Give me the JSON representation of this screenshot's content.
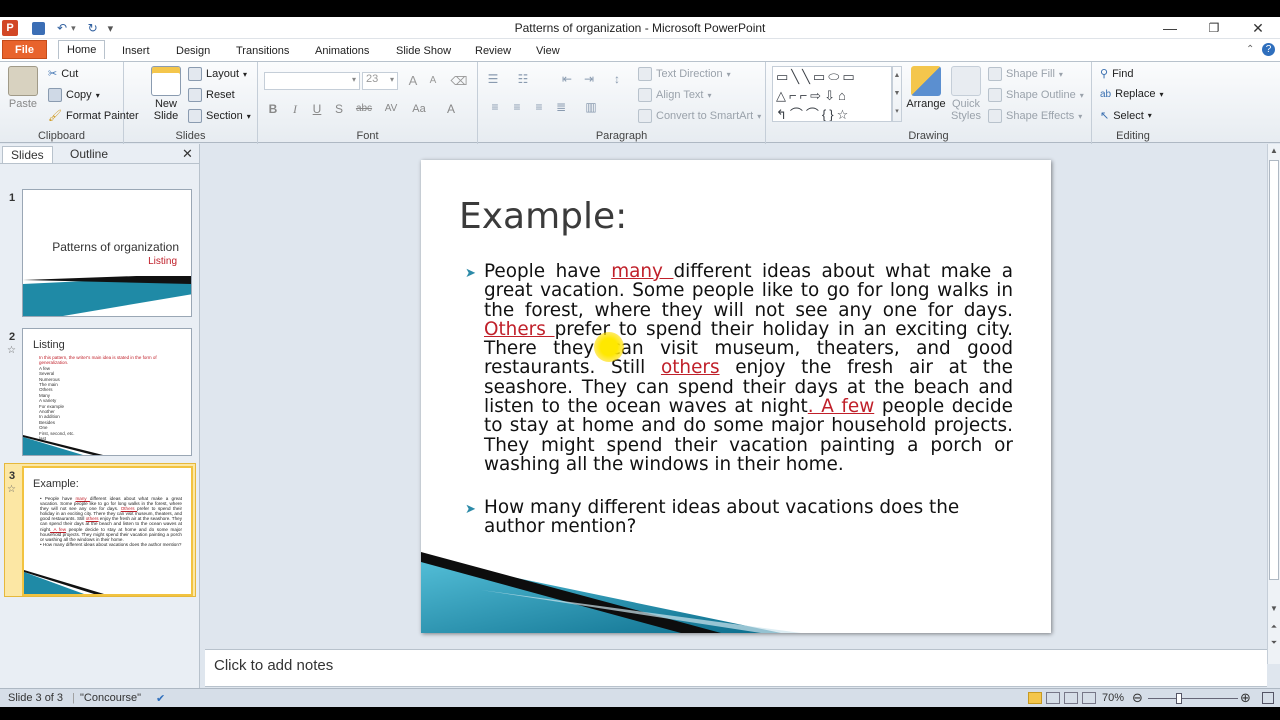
{
  "window": {
    "title": "Patterns of organization  -  Microsoft PowerPoint"
  },
  "tabs": [
    "File",
    "Home",
    "Insert",
    "Design",
    "Transitions",
    "Animations",
    "Slide Show",
    "Review",
    "View"
  ],
  "ribbon": {
    "clipboard": {
      "label": "Clipboard",
      "paste": "Paste",
      "cut": "Cut",
      "copy": "Copy",
      "format_painter": "Format Painter"
    },
    "slides": {
      "label": "Slides",
      "new_slide": "New Slide",
      "layout": "Layout",
      "reset": "Reset",
      "section": "Section"
    },
    "font": {
      "label": "Font",
      "font_name": "",
      "font_size": "23",
      "bold": "B",
      "italic": "I",
      "underline": "U",
      "shadow": "S",
      "strike": "abc",
      "spacing": "AV",
      "case": "Aa",
      "color": "A"
    },
    "paragraph": {
      "label": "Paragraph",
      "text_direction": "Text Direction",
      "align_text": "Align Text",
      "convert_smartart": "Convert to SmartArt"
    },
    "drawing": {
      "label": "Drawing",
      "arrange": "Arrange",
      "quick_styles": "Quick Styles",
      "shape_fill": "Shape Fill",
      "shape_outline": "Shape Outline",
      "shape_effects": "Shape Effects"
    },
    "editing": {
      "label": "Editing",
      "find": "Find",
      "replace": "Replace",
      "select": "Select"
    }
  },
  "pane": {
    "tab_slides": "Slides",
    "tab_outline": "Outline",
    "close": "✕"
  },
  "thumbnails": [
    {
      "num": "1",
      "title": "Patterns of organization",
      "subtitle": "Listing"
    },
    {
      "num": "2",
      "title": "Listing",
      "lines": [
        "In this pattern, the writer's main idea is stated in the form of generalization.",
        "A few",
        "Several",
        "Numerous",
        "The main",
        "Others",
        "Many",
        "A variety",
        "For example",
        "Another",
        "In addition",
        "Besides",
        "One",
        "First, second, etc.",
        "last"
      ]
    },
    {
      "num": "3",
      "title": "Example:"
    }
  ],
  "slide": {
    "title": "Example:",
    "p1": {
      "t1": "People have ",
      "r1": "many ",
      "t2": "different ideas about what make a great vacation. Some people like to go for long walks in the forest, where they will not  see any one for days. ",
      "r2": "Others ",
      "t3": "prefer to spend their holiday in an exciting city. There they can visit museum, theaters, and good restaurants. Still ",
      "r3": "others",
      "t4": " enjoy the fresh air at the seashore. They can spend their days at the beach and listen to the ocean waves at night",
      "r4": ". A few",
      "t5": " people decide to stay at home and do some major household projects. They might spend their vacation painting a porch or washing all the windows in their home."
    },
    "p2": "How many different ideas about vacations does the author mention?"
  },
  "notes": {
    "placeholder": "Click to add notes"
  },
  "status": {
    "slide": "Slide 3 of 3",
    "theme": "\"Concourse\"",
    "zoom": "70%"
  },
  "colors": {
    "accent_red": "#c0202a",
    "bullet": "#2c8aa8",
    "file_tab": "#e8632c"
  }
}
